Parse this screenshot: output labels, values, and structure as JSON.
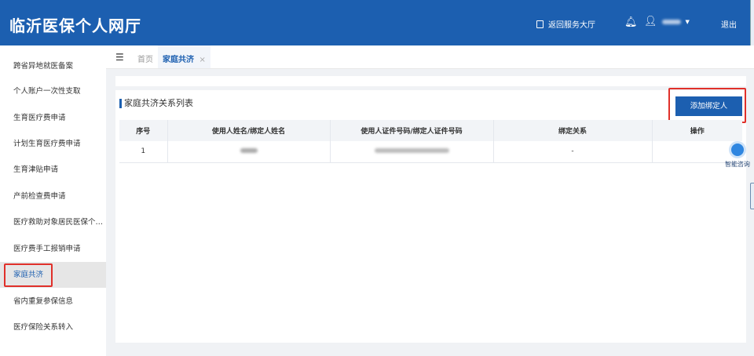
{
  "header": {
    "title": "临沂医保个人网厅",
    "return_label": "返回服务大厅",
    "logout_label": "退出"
  },
  "sidebar": {
    "items": [
      "跨省异地就医备案",
      "个人账户一次性支取",
      "生育医疗费申请",
      "计划生育医疗费申请",
      "生育津贴申请",
      "产前检查费申请",
      "医疗救助对象居民医保个…",
      "医疗费手工报销申请",
      "家庭共济",
      "省内重复参保信息",
      "医疗保险关系转入"
    ],
    "active_index": 8
  },
  "tabs": {
    "home": "首页",
    "current": "家庭共济",
    "close": "×"
  },
  "main": {
    "section_title": "家庭共济关系列表",
    "add_button": "添加绑定人",
    "columns": [
      "序号",
      "使用人姓名/绑定人姓名",
      "使用人证件号码/绑定人证件号码",
      "绑定关系",
      "操作"
    ],
    "rows": [
      {
        "index": "1",
        "relation": "-"
      }
    ]
  },
  "float": {
    "consult_label": "智能咨询"
  },
  "colors": {
    "primary": "#1c5fb0",
    "highlight": "#e0302a"
  }
}
